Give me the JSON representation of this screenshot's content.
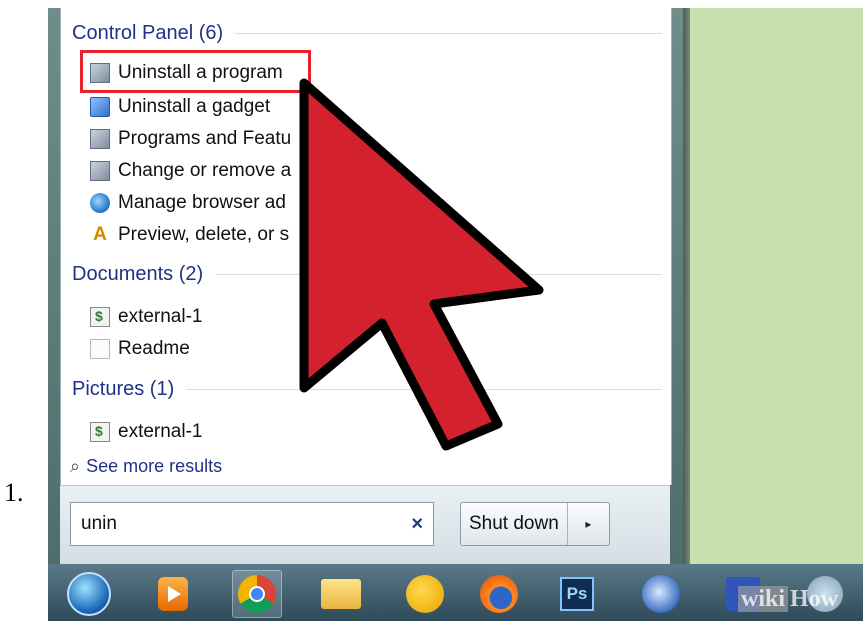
{
  "step_number": "1.",
  "start_menu": {
    "sections": [
      {
        "heading": "Control Panel (6)",
        "items": [
          {
            "label": "Uninstall a program",
            "icon": "programs-icon"
          },
          {
            "label": "Uninstall a gadget",
            "icon": "gadget-icon"
          },
          {
            "label": "Programs and Featu",
            "icon": "programs-icon"
          },
          {
            "label": "Change or remove a",
            "icon": "programs-icon"
          },
          {
            "label": "Manage browser ad",
            "icon": "globe-icon"
          },
          {
            "label": "Preview, delete, or s",
            "icon": "text-icon"
          }
        ]
      },
      {
        "heading": "Documents (2)",
        "items": [
          {
            "label": "external-1",
            "icon": "script-document-icon"
          },
          {
            "label": "Readme",
            "icon": "text-document-icon"
          }
        ]
      },
      {
        "heading": "Pictures (1)",
        "items": [
          {
            "label": "external-1",
            "icon": "script-document-icon"
          }
        ]
      }
    ],
    "see_more": "See more results",
    "search": {
      "value": "unin",
      "clear_symbol": "×"
    },
    "shutdown": {
      "label": "Shut down",
      "arrow": "▸"
    }
  },
  "taskbar": {
    "apps": [
      "start-orb",
      "media-player",
      "chrome",
      "file-explorer",
      "yahoo-messenger",
      "firefox",
      "photoshop",
      "thunderbird",
      "save-disk",
      "misc-app"
    ],
    "photoshop_label": "Ps"
  },
  "watermark": {
    "wiki": "wiki",
    "how": "How"
  },
  "colors": {
    "highlight": "#e8212b",
    "arrow": "#d3212e",
    "section_heading": "#1e3287",
    "desktop": "#c7e0ae"
  }
}
